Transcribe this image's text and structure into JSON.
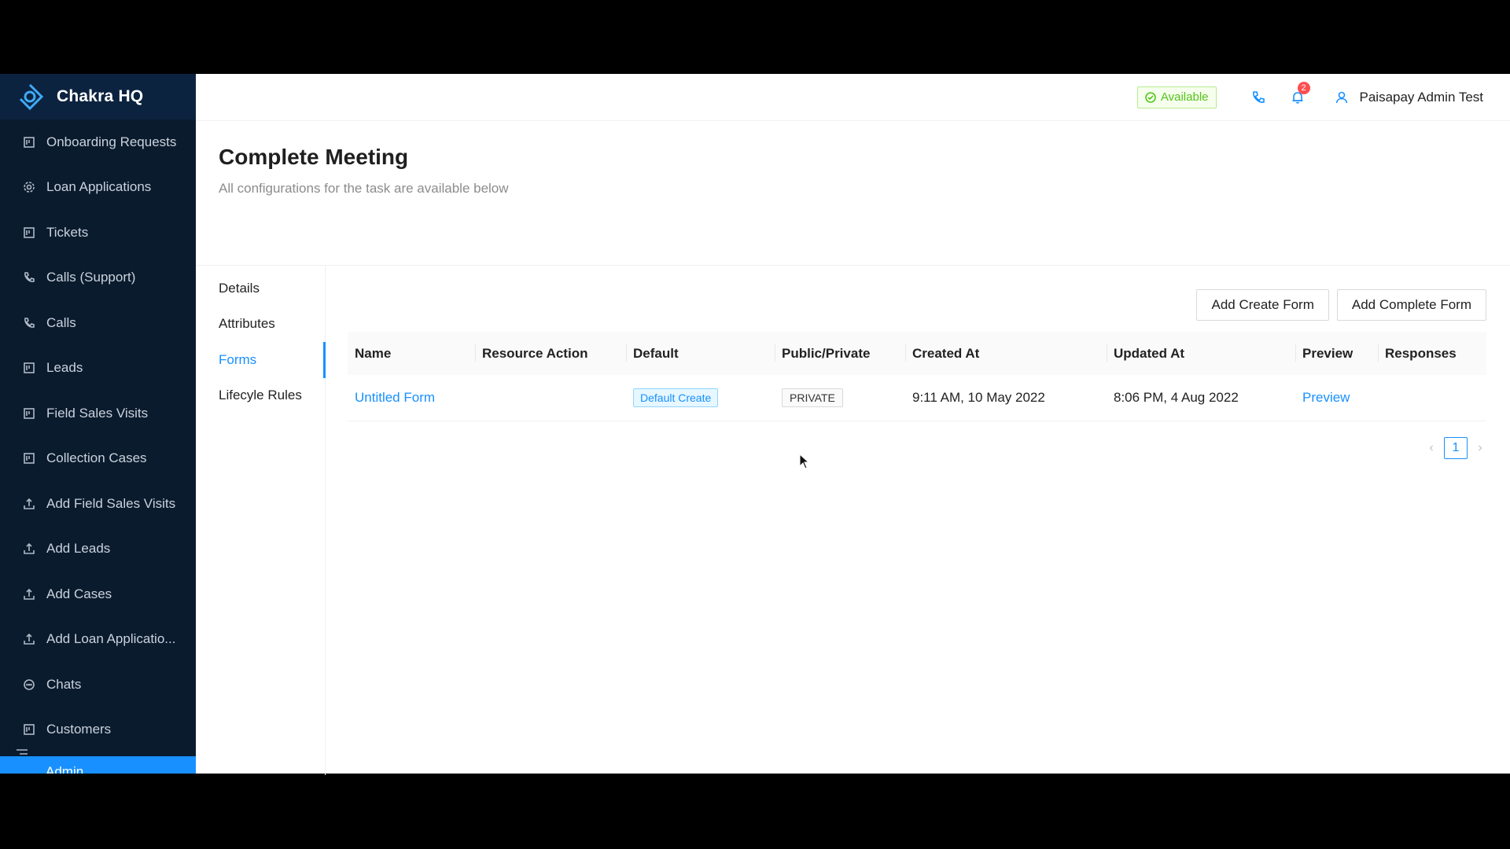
{
  "brand": {
    "name": "Chakra HQ"
  },
  "sidebar": {
    "items": [
      {
        "label": "Onboarding Requests",
        "icon": "board-icon"
      },
      {
        "label": "Loan Applications",
        "icon": "gear-icon"
      },
      {
        "label": "Tickets",
        "icon": "board-icon"
      },
      {
        "label": "Calls (Support)",
        "icon": "phone-icon"
      },
      {
        "label": "Calls",
        "icon": "phone-icon"
      },
      {
        "label": "Leads",
        "icon": "board-icon"
      },
      {
        "label": "Field Sales Visits",
        "icon": "board-icon"
      },
      {
        "label": "Collection Cases",
        "icon": "board-icon"
      },
      {
        "label": "Add Field Sales Visits",
        "icon": "upload-icon"
      },
      {
        "label": "Add Leads",
        "icon": "upload-icon"
      },
      {
        "label": "Add Cases",
        "icon": "upload-icon"
      },
      {
        "label": "Add Loan Applicatio...",
        "icon": "upload-icon"
      },
      {
        "label": "Chats",
        "icon": "chat-icon"
      },
      {
        "label": "Customers",
        "icon": "board-icon"
      }
    ],
    "admin_label": "Admin"
  },
  "topbar": {
    "status": "Available",
    "notification_count": "2",
    "user_name": "Paisapay Admin Test"
  },
  "page": {
    "title": "Complete Meeting",
    "subtitle": "All configurations for the task are available below"
  },
  "tabs": [
    "Details",
    "Attributes",
    "Forms",
    "Lifecyle Rules"
  ],
  "actions": {
    "add_create_form": "Add Create Form",
    "add_complete_form": "Add Complete Form"
  },
  "table": {
    "headers": [
      "Name",
      "Resource Action",
      "Default",
      "Public/Private",
      "Created At",
      "Updated At",
      "Preview",
      "Responses"
    ],
    "rows": [
      {
        "name": "Untitled Form",
        "resource_action": "",
        "default": "Default Create",
        "visibility": "PRIVATE",
        "created_at": "9:11 AM, 10 May 2022",
        "updated_at": "8:06 PM, 4 Aug 2022",
        "preview": "Preview",
        "responses": ""
      }
    ]
  },
  "pagination": {
    "current_page": "1"
  },
  "colors": {
    "sidebar_bg": "#0b1b2e",
    "accent": "#1890ff",
    "success": "#52c41a",
    "badge": "#ff4d4f"
  }
}
